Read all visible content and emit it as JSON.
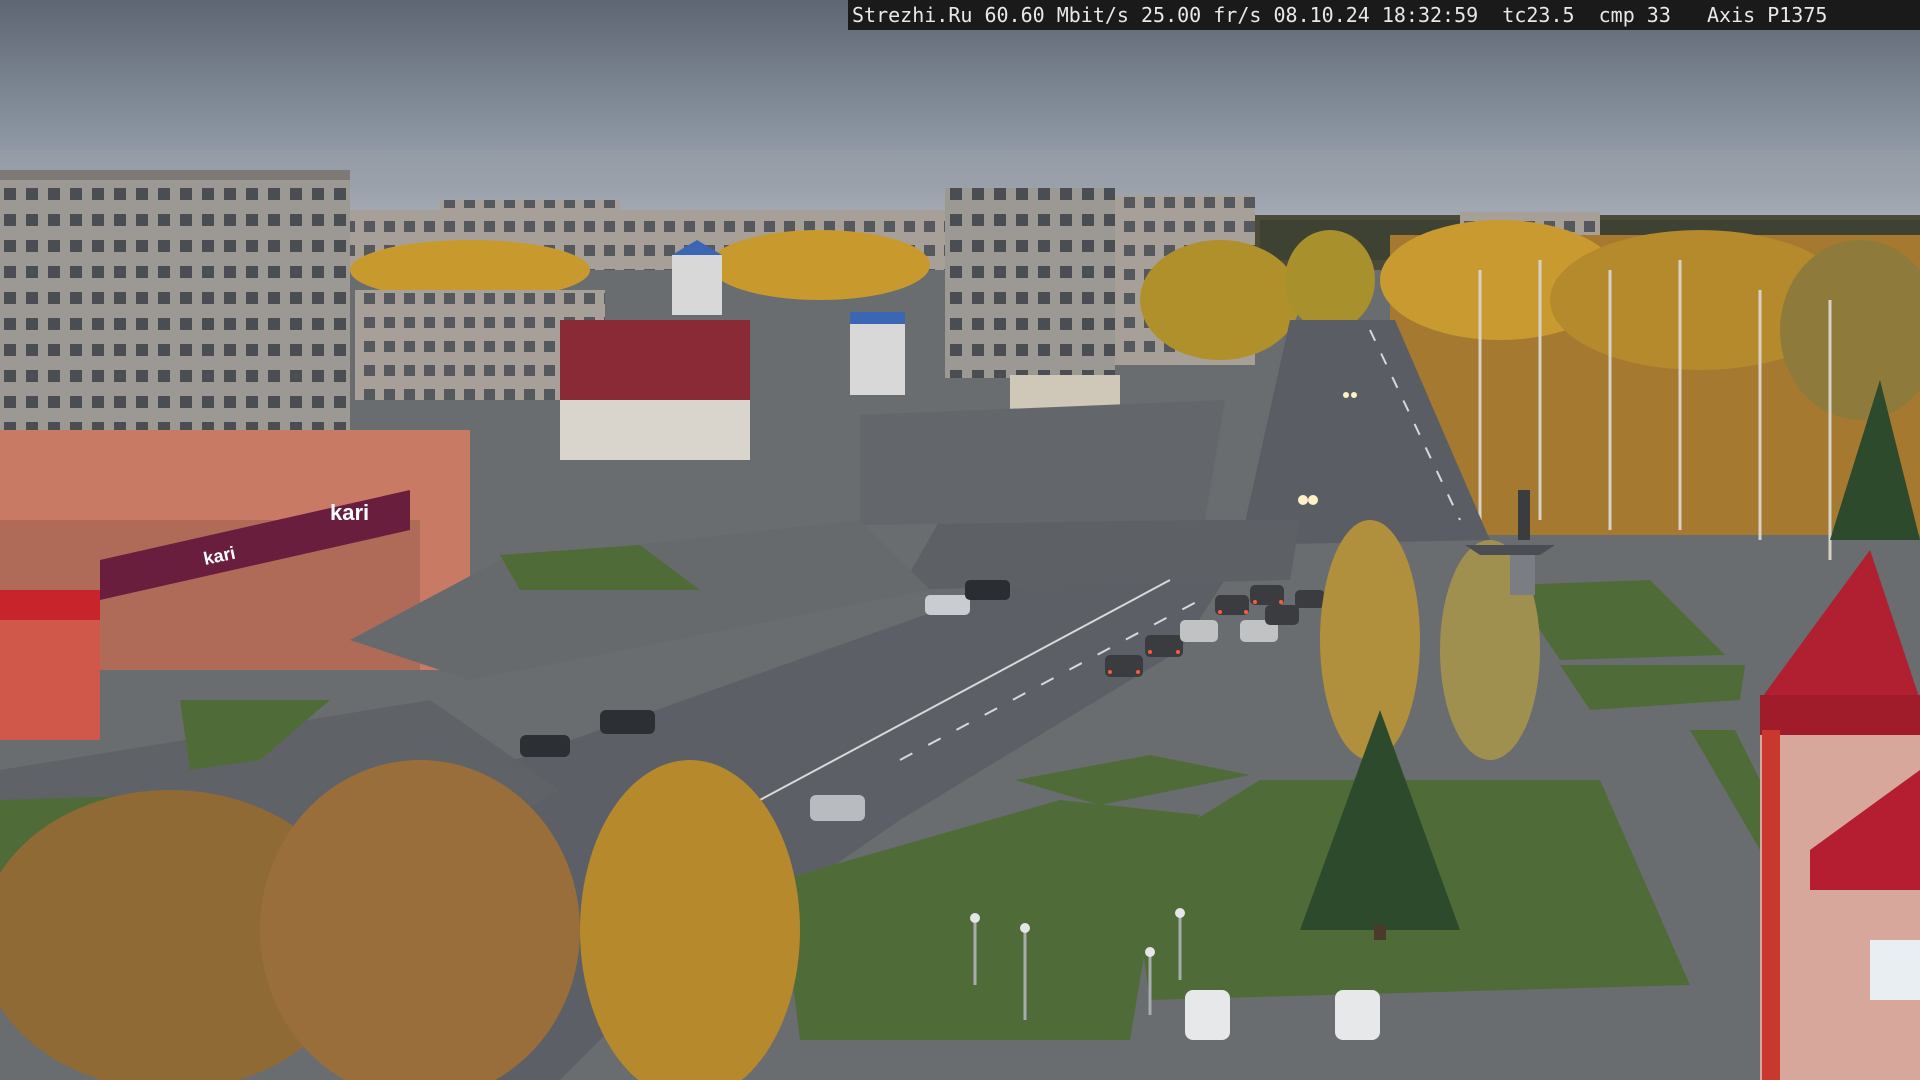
{
  "overlay": {
    "site": "Strezhi.Ru",
    "bitrate": "60.60 Mbit/s",
    "framerate": "25.00 fr/s",
    "datetime": "08.10.24 18:32:59",
    "tc": "tc23.5",
    "cmp": "cmp 33",
    "camera": "Axis P1375"
  },
  "signs": {
    "store_brand": "kari",
    "store_brand_2": "kari"
  },
  "scene": {
    "time_of_day": "dusk",
    "season": "autumn",
    "sky_color": "#7f8894",
    "foliage_color": "#c89a2e",
    "road_color": "#5c6066"
  }
}
